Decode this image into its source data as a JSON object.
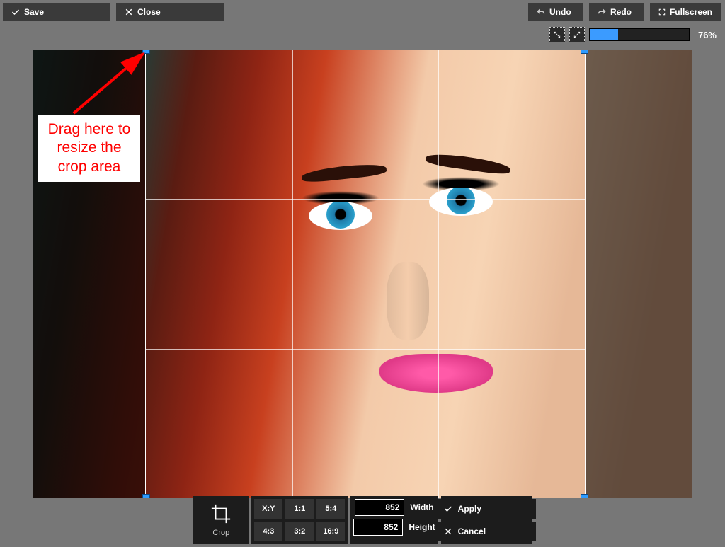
{
  "toolbar": {
    "save": "Save",
    "close": "Close",
    "undo": "Undo",
    "redo": "Redo",
    "fullscreen": "Fullscreen",
    "zoom_pct": "76%"
  },
  "callout": {
    "text": "Drag here to resize the crop area"
  },
  "crop_panel": {
    "label": "Crop",
    "ratios": [
      "X:Y",
      "1:1",
      "5:4",
      "4:3",
      "3:2",
      "16:9"
    ],
    "width_label": "Width",
    "height_label": "Height",
    "width_value": "852",
    "height_value": "852",
    "apply": "Apply",
    "cancel": "Cancel"
  }
}
